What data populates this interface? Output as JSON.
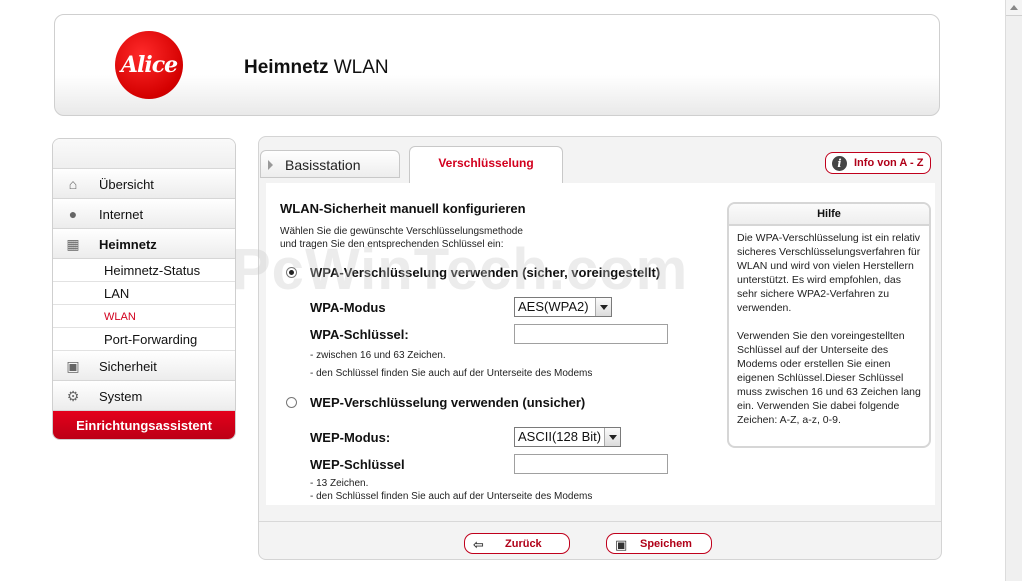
{
  "header": {
    "logo_text": "Alice",
    "title_strong": "Heimnetz",
    "title_rest": " WLAN"
  },
  "nav": {
    "items": [
      {
        "label": "Übersicht",
        "icon": "house-icon"
      },
      {
        "label": "Internet",
        "icon": "globe-icon"
      },
      {
        "label": "Heimnetz",
        "icon": "network-icon"
      }
    ],
    "subitems": [
      {
        "label": "Heimnetz-Status"
      },
      {
        "label": "LAN"
      },
      {
        "label": "WLAN"
      },
      {
        "label": "Port-Forwarding"
      }
    ],
    "items_after": [
      {
        "label": "Sicherheit",
        "icon": "lock-icon"
      },
      {
        "label": "System",
        "icon": "gear-icon"
      }
    ],
    "assistant": "Einrichtungsassistent"
  },
  "tabs": {
    "basis": "Basisstation",
    "active": "Verschlüsselung"
  },
  "info_button": "Info von A - Z",
  "form": {
    "heading": "WLAN-Sicherheit manuell konfigurieren",
    "intro_line1": "Wählen Sie die gewünschte Verschlüsselungsmethode",
    "intro_line2": "und tragen Sie den entsprechenden Schlüssel ein:",
    "wpa_option": "WPA-Verschlüsselung verwenden (sicher, voreingestellt)",
    "wpa_mode_label": "WPA-Modus",
    "wpa_mode_value": "AES(WPA2)",
    "wpa_key_label": "WPA-Schlüssel:",
    "wpa_hint1": "- zwischen 16 und 63 Zeichen.",
    "wpa_hint2": "- den Schlüssel finden Sie auch auf der Unterseite des Modems",
    "wep_option": "WEP-Verschlüsselung verwenden (unsicher)",
    "wep_mode_label": "WEP-Modus:",
    "wep_mode_value": "ASCII(128 Bit)",
    "wep_key_label": "WEP-Schlüssel",
    "wep_hint1": "- 13 Zeichen.",
    "wep_hint2": "- den Schlüssel finden Sie auch auf der Unterseite des Modems"
  },
  "help": {
    "title": "Hilfe",
    "para1": "Die WPA-Verschlüsselung ist ein relativ sicheres Verschlüsselungsverfahren für WLAN und wird von vielen Herstellern unterstützt. Es wird empfohlen, das sehr sichere WPA2-Verfahren zu verwenden.",
    "para2": "Verwenden Sie den voreingestellten Schlüssel auf der Unterseite des Modems oder erstellen Sie einen eigenen Schlüssel.Dieser Schlüssel muss zwischen 16 und 63 Zeichen lang ein. Verwenden Sie dabei folgende Zeichen: A-Z, a-z, 0-9."
  },
  "footer": {
    "back": "Zurück",
    "save": "Speichem"
  },
  "watermark": "PcWinTech.com",
  "colors": {
    "accent": "#d2001e"
  }
}
